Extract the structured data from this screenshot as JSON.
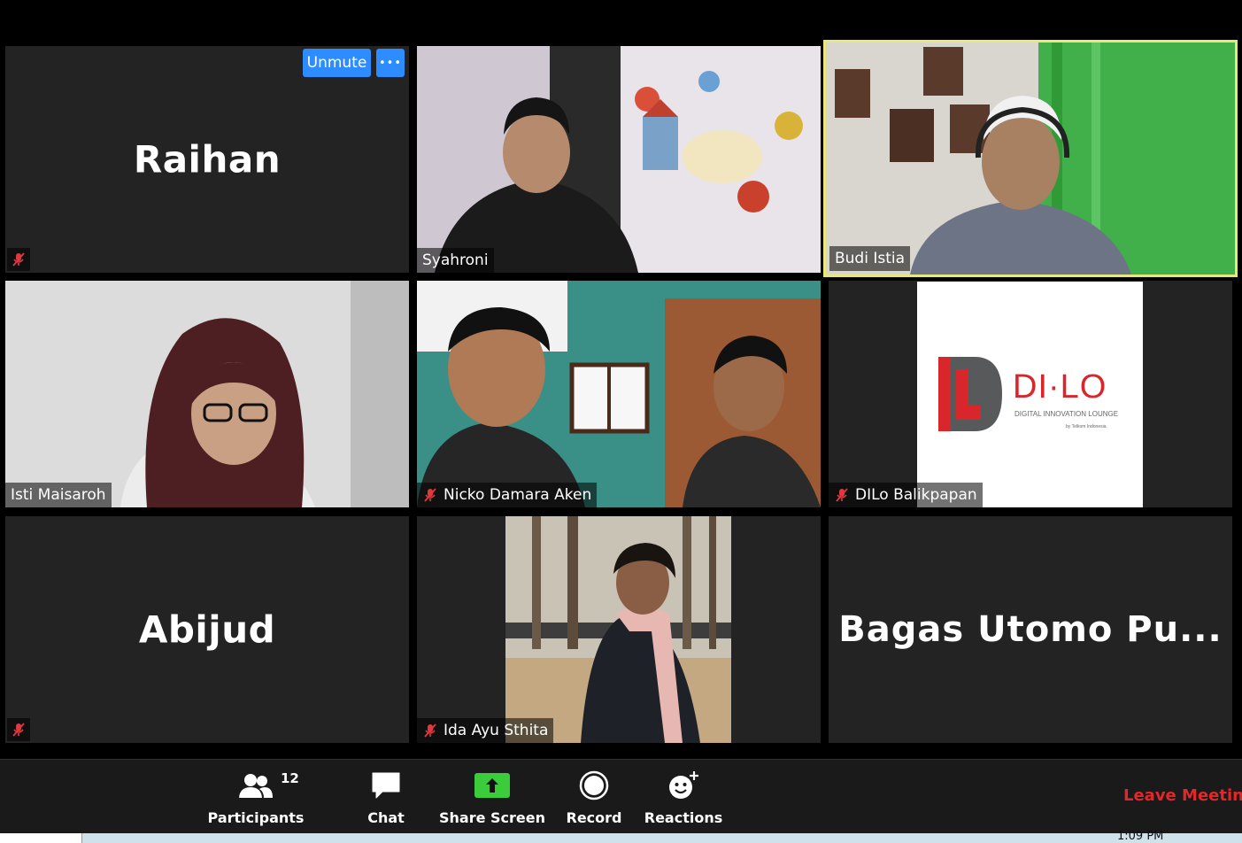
{
  "participants_tiles": [
    {
      "name": "Raihan",
      "display": "name"
    },
    {
      "name": "Syahroni",
      "display": "video"
    },
    {
      "name": "Budi Istia",
      "display": "video",
      "active_speaker": true
    },
    {
      "name": "Isti Maisaroh",
      "display": "video"
    },
    {
      "name": "Nicko Damara Aken",
      "display": "video"
    },
    {
      "name": "DILo Balikpapan",
      "display": "logo"
    },
    {
      "name": "Abijud",
      "display": "name"
    },
    {
      "name": "Ida Ayu Sthita",
      "display": "video"
    },
    {
      "name": "Bagas Utomo Pu...",
      "display": "name"
    }
  ],
  "tile_controls": {
    "unmute_label": "Unmute",
    "more_label": "•••"
  },
  "logo": {
    "brand": "DI·LO",
    "subtitle": "DIGITAL INNOVATION LOUNGE",
    "byline": "by Telkom Indonesia"
  },
  "toolbar": {
    "participants_label": "Participants",
    "participants_count": "12",
    "chat_label": "Chat",
    "share_label": "Share Screen",
    "record_label": "Record",
    "reactions_label": "Reactions",
    "leave_label": "Leave Meeting"
  },
  "taskbar": {
    "clock": "1:09 PM"
  },
  "colors": {
    "accent": "#2d8cff",
    "share_green": "#3bcc3b",
    "leave_red": "#e02828",
    "active_border": "#e8e87a",
    "mute_red": "#e0383e"
  }
}
